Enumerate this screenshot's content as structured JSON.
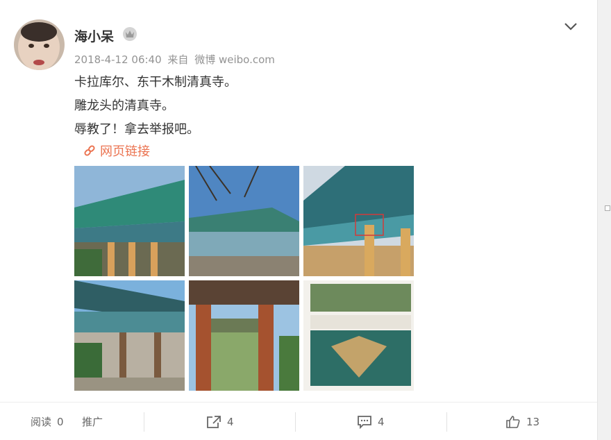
{
  "post": {
    "username": "海小呆",
    "timestamp": "2018-4-12 06:40",
    "source_prefix": "来自",
    "source": "微博 weibo.com",
    "lines": [
      "卡拉库尔、东干木制清真寺。",
      "雕龙头的清真寺。",
      "辱教了！拿去举报吧。"
    ],
    "link_text": "网页链接",
    "link_color": "#eb7350"
  },
  "images": [
    {
      "name": "mosque-roof-corner",
      "icon": "photo"
    },
    {
      "name": "mosque-courtyard",
      "icon": "photo"
    },
    {
      "name": "mosque-dragon-eave",
      "icon": "photo"
    },
    {
      "name": "mosque-veranda",
      "icon": "photo"
    },
    {
      "name": "mosque-gate",
      "icon": "photo"
    },
    {
      "name": "article-page-scan",
      "icon": "photo"
    }
  ],
  "actions": {
    "read_label": "阅读",
    "read_count": "0",
    "promote_label": "推广",
    "share_count": "4",
    "comment_count": "4",
    "like_count": "13"
  }
}
